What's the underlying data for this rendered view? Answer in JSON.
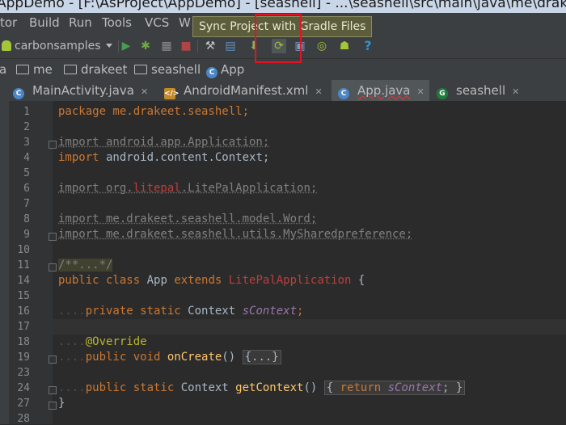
{
  "window": {
    "title": "AppDemo - [F:\\AsProject\\AppDemo] - [seashell] - ...\\seashell\\src\\main\\java\\me\\drakeet\\seashell\\App.java"
  },
  "menu": [
    "tor",
    "Build",
    "Run",
    "Tools",
    "VCS",
    "W"
  ],
  "toolbar": {
    "run_config": "carbonsamples",
    "tooltip": "Sync Project with Gradle Files",
    "icons": [
      "run-icon",
      "debug-icon",
      "coverage-icon",
      "stop-icon",
      "attach-debugger-icon",
      "project-structure-icon",
      "sdk-manager-icon",
      "gradle-sync-icon",
      "avd-manager-icon",
      "android-device-monitor-icon",
      "android-icon",
      "help-icon"
    ],
    "colors": {
      "run": "#499c54",
      "debug": "#6da843",
      "highlight": "#e81123",
      "help": "#3592c4"
    }
  },
  "breadcrumb": [
    "a",
    "me",
    "drakeet",
    "seashell",
    "App"
  ],
  "tabs": [
    {
      "label": "MainActivity.java",
      "icon": "class-icon",
      "active": false
    },
    {
      "label": "AndroidManifest.xml",
      "icon": "manifest-icon",
      "active": false
    },
    {
      "label": "App.java",
      "icon": "class-icon",
      "active": true
    },
    {
      "label": "seashell",
      "icon": "gradle-icon",
      "active": false
    }
  ],
  "editor": {
    "line_numbers": [
      "1",
      "2",
      "3",
      "4",
      "5",
      "6",
      "7",
      "8",
      "9",
      "10",
      "11",
      "14",
      "15",
      "16",
      "17",
      "18",
      "19",
      "23",
      "24",
      "27",
      "28"
    ],
    "lines": {
      "l1": "package me.drakeet.seashell;",
      "l3": "import android.app.Application;",
      "l4a": "import",
      "l4b": " android.content.Context;",
      "l6a": "import org.",
      "l6b": "litepal",
      "l6c": ".LitePalApplication;",
      "l8": "import me.drakeet.seashell.model.Word;",
      "l9": "import me.drakeet.seashell.utils.MySharedpreference;",
      "l11": "/**...*/",
      "l14a": "public class",
      "l14b": " App ",
      "l14c": "extends",
      "l14d": " LitePalApplication",
      "l14e": " {",
      "l16a": "private static",
      "l16b": " Context ",
      "l16c": "sContext",
      "l16d": ";",
      "l18": "@Override",
      "l19a": "public void",
      "l19b": " onCreate",
      "l19c": "() ",
      "l19d": "{...}",
      "l24a": "public static",
      "l24b": " Context ",
      "l24c": "getContext",
      "l24d": "() ",
      "l24e": "{ ",
      "l24f": "return",
      "l24g": " sContext",
      "l24h": "; }",
      "l27": "}"
    }
  },
  "indent_dots": "...."
}
